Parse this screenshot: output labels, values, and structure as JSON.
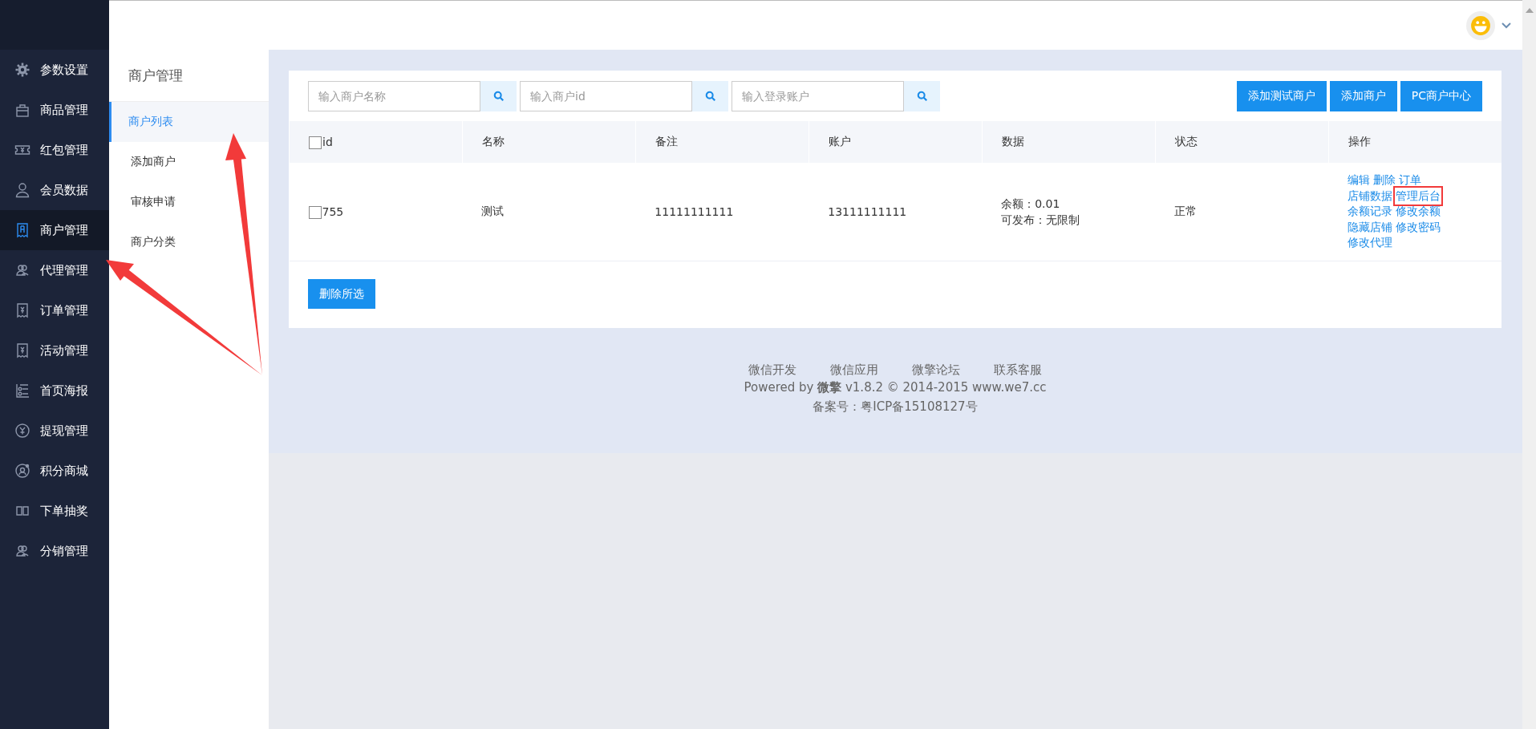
{
  "sidebar": {
    "items": [
      {
        "label": "参数设置",
        "selected": false
      },
      {
        "label": "商品管理",
        "selected": false
      },
      {
        "label": "红包管理",
        "selected": false
      },
      {
        "label": "会员数据",
        "selected": false
      },
      {
        "label": "商户管理",
        "selected": true
      },
      {
        "label": "代理管理",
        "selected": false
      },
      {
        "label": "订单管理",
        "selected": false
      },
      {
        "label": "活动管理",
        "selected": false
      },
      {
        "label": "首页海报",
        "selected": false
      },
      {
        "label": "提现管理",
        "selected": false
      },
      {
        "label": "积分商城",
        "selected": false
      },
      {
        "label": "下单抽奖",
        "selected": false
      },
      {
        "label": "分销管理",
        "selected": false
      }
    ]
  },
  "submenu": {
    "title": "商户管理",
    "items": [
      {
        "label": "商户列表",
        "selected": true
      },
      {
        "label": "添加商户",
        "selected": false
      },
      {
        "label": "审核申请",
        "selected": false
      },
      {
        "label": "商户分类",
        "selected": false
      }
    ]
  },
  "search_fields": [
    {
      "placeholder": "输入商户名称"
    },
    {
      "placeholder": "输入商户id"
    },
    {
      "placeholder": "输入登录账户"
    }
  ],
  "toolbar_buttons": [
    "添加测试商户",
    "添加商户",
    "PC商户中心"
  ],
  "table": {
    "all_checked": false,
    "columns": [
      "id",
      "名称",
      "备注",
      "账户",
      "数据",
      "状态",
      "操作"
    ],
    "rows": [
      {
        "checked": false,
        "id": "755",
        "name": "测试",
        "remark": "11111111111",
        "account": "13111111111",
        "data": [
          "余额：0.01",
          "可发布：无限制"
        ],
        "status": "正常",
        "actions": [
          [
            {
              "label": "编辑",
              "highlighted": false
            },
            {
              "label": "删除",
              "highlighted": false
            },
            {
              "label": "订单",
              "highlighted": false
            }
          ],
          [
            {
              "label": "店铺数据",
              "highlighted": false
            },
            {
              "label": "管理后台",
              "highlighted": true
            }
          ],
          [
            {
              "label": "余额记录",
              "highlighted": false
            },
            {
              "label": "修改余额",
              "highlighted": false
            }
          ],
          [
            {
              "label": "隐藏店铺",
              "highlighted": false
            },
            {
              "label": "修改密码",
              "highlighted": false
            }
          ],
          [
            {
              "label": "修改代理",
              "highlighted": false
            }
          ]
        ]
      }
    ]
  },
  "delete_button": "删除所选",
  "footer": {
    "links": [
      "微信开发",
      "微信应用",
      "微擎论坛",
      "联系客服"
    ],
    "powered": "Powered by **微擎** v1.8.2 © 2014-2015 www.we7.cc",
    "record": "备案号：粤ICP备15108127号"
  }
}
